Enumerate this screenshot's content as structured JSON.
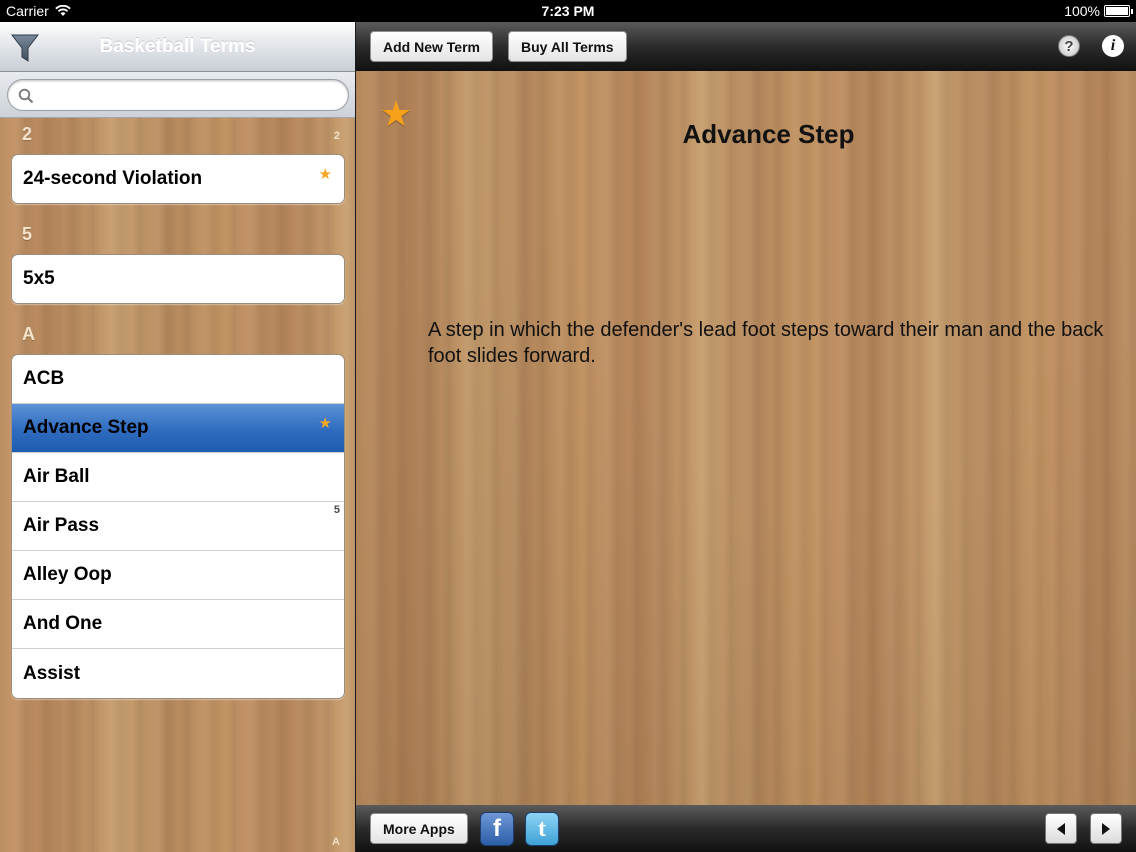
{
  "status_bar": {
    "carrier": "Carrier",
    "time": "7:23 PM",
    "battery": "100%"
  },
  "sidebar": {
    "title": "Basketball Terms",
    "search": {
      "placeholder": "",
      "value": ""
    },
    "sections": [
      {
        "header": "2",
        "index": "2",
        "items": [
          {
            "label": "24-second Violation",
            "favorite": true
          }
        ]
      },
      {
        "header": "5",
        "items": [
          {
            "label": "5x5",
            "favorite": false
          }
        ]
      },
      {
        "header": "A",
        "items": [
          {
            "label": "ACB",
            "favorite": false
          },
          {
            "label": "Advance Step",
            "favorite": true,
            "selected": true
          },
          {
            "label": "Air Ball",
            "favorite": false
          },
          {
            "label": "Air Pass",
            "favorite": false
          },
          {
            "label": "Alley Oop",
            "favorite": false
          },
          {
            "label": "And One",
            "favorite": false
          },
          {
            "label": "Assist",
            "favorite": false
          }
        ]
      }
    ],
    "side_index": {
      "mid": "5",
      "bottom": "A"
    }
  },
  "toolbar": {
    "add_new_term": "Add New Term",
    "buy_all_terms": "Buy All Terms",
    "help_icon": "?",
    "info_icon": "i"
  },
  "detail": {
    "favorite": true,
    "title": "Advance Step",
    "definition": "A step in which the defender's lead foot steps toward their man and the back foot slides forward."
  },
  "bottom_bar": {
    "more_apps": "More Apps",
    "facebook_icon": "f",
    "twitter_icon": "t"
  },
  "colors": {
    "selection": "#2f6cc0",
    "star": "#f5a623",
    "wood": "#c49567"
  }
}
